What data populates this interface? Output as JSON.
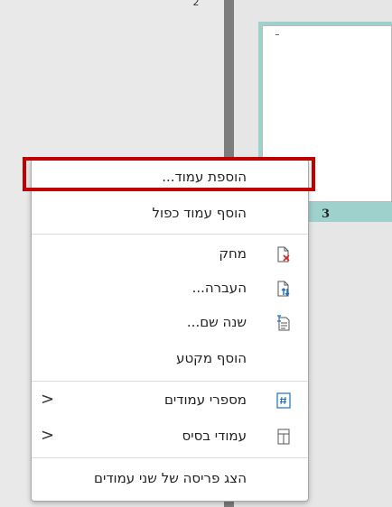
{
  "thumbnails": {
    "top_number": "2",
    "page_label": "3"
  },
  "menu": {
    "items": [
      {
        "label": "הוספת עמוד...",
        "icon": "",
        "submenu": false
      },
      {
        "label": "הוסף עמוד כפול",
        "icon": "",
        "submenu": false
      },
      {
        "label": "מחק",
        "icon": "delete-page-icon",
        "submenu": false
      },
      {
        "label": "העברה...",
        "icon": "move-page-icon",
        "submenu": false
      },
      {
        "label": "שנה שם...",
        "icon": "rename-icon",
        "submenu": false
      },
      {
        "label": "הוסף מקטע",
        "icon": "",
        "submenu": false
      },
      {
        "label": "מספרי עמודים",
        "icon": "page-numbers-icon",
        "submenu": true
      },
      {
        "label": "עמודי בסיס",
        "icon": "master-pages-icon",
        "submenu": true
      },
      {
        "label": "הצג פריסה של שני עמודים",
        "icon": "",
        "submenu": false
      }
    ],
    "submenu_arrow": "<"
  },
  "colors": {
    "highlight": "#c00000",
    "thumb_selection": "#9fd1cc"
  }
}
